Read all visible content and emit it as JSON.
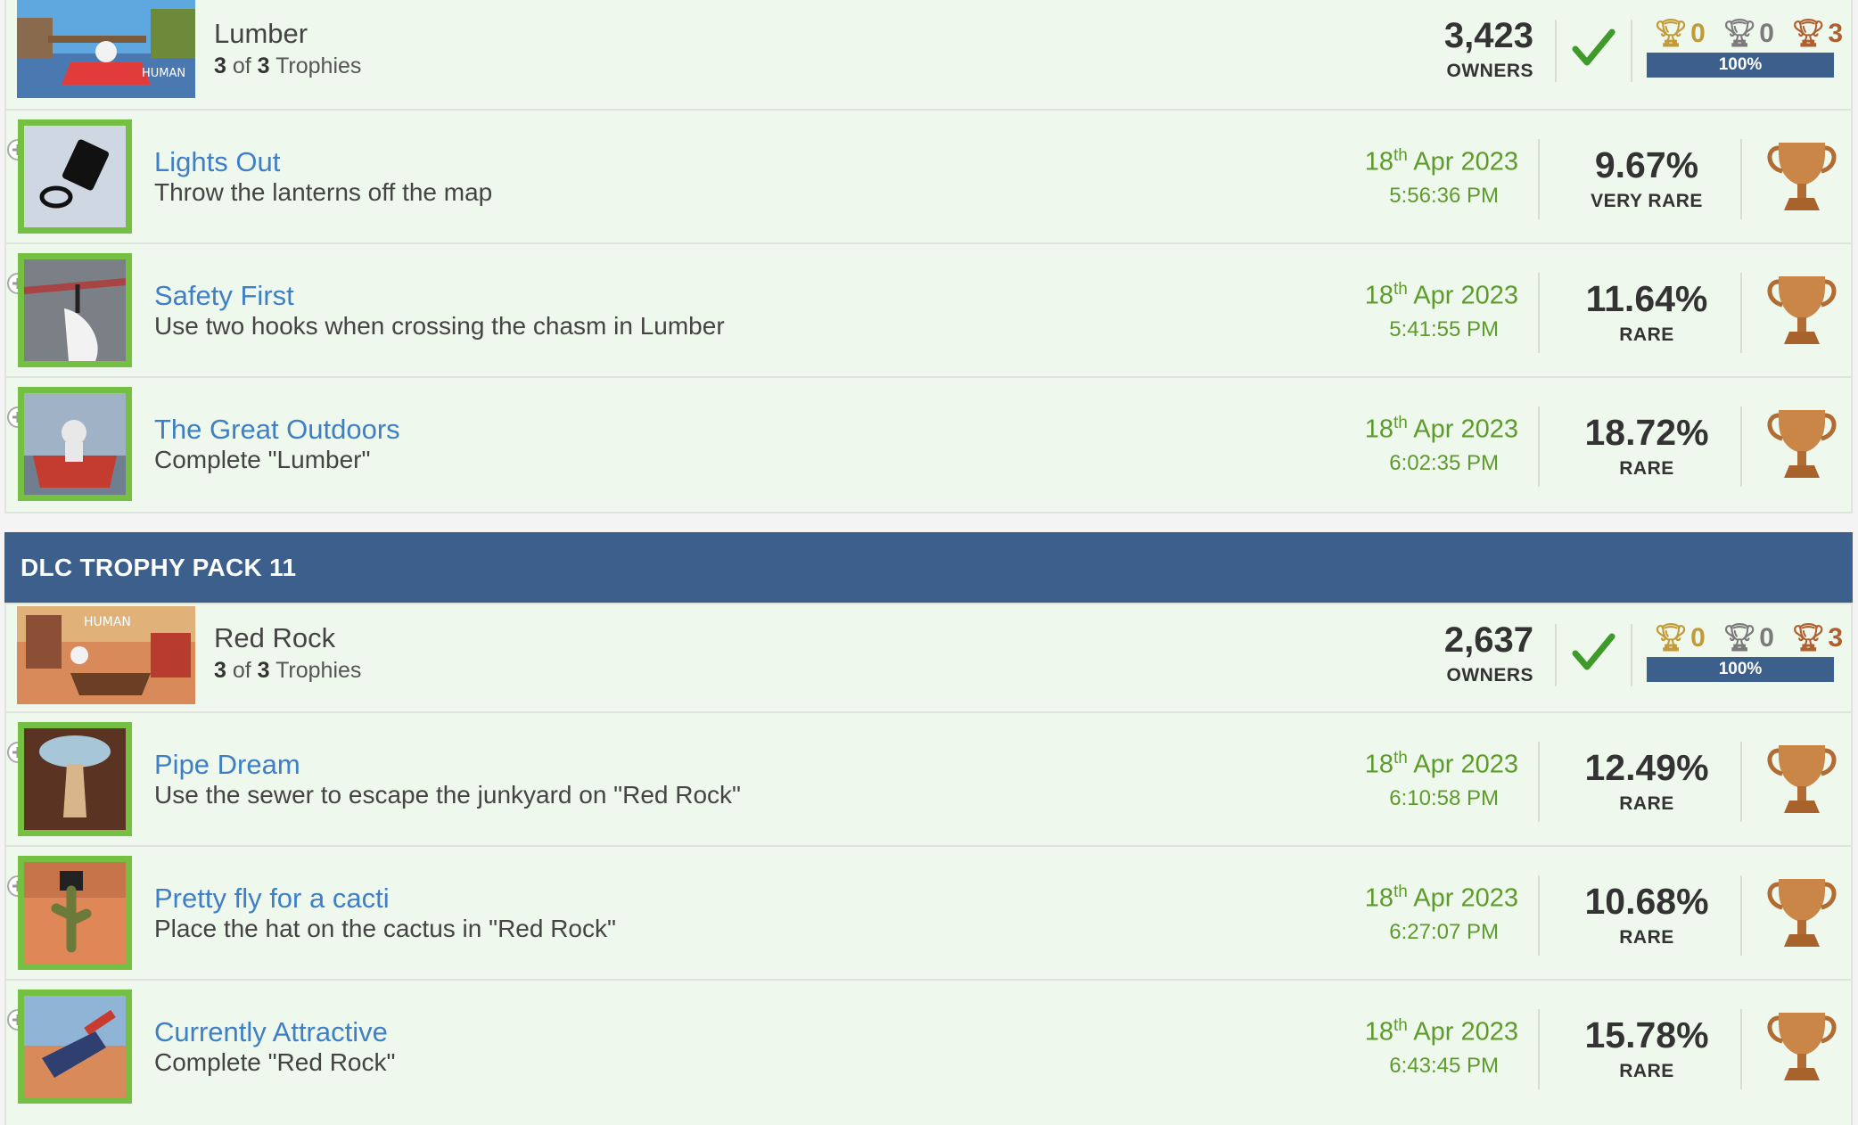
{
  "colors": {
    "accent_blue": "#3d5f8c",
    "link_blue": "#3e7fc6",
    "earned_green": "#5d9c2c",
    "row_bg": "#eff8ec",
    "bronze": "#b0602f"
  },
  "groups": [
    {
      "game": {
        "name": "Lumber",
        "earned": "3",
        "of": "of",
        "total": "3",
        "suffix": "Trophies",
        "owners": "3,423",
        "owners_label": "OWNERS",
        "gold": "0",
        "silver": "0",
        "bronze": "3",
        "progress": "100%"
      },
      "trophies": [
        {
          "name": "Lights Out",
          "desc": "Throw the lanterns off the map",
          "day": "18",
          "day_suffix": "th",
          "date_rest": " Apr 2023",
          "time": "5:56:36 PM",
          "pct": "9.67%",
          "rarity": "VERY RARE",
          "type": "bronze-trophy-icon"
        },
        {
          "name": "Safety First",
          "desc": "Use two hooks when crossing the chasm in Lumber",
          "day": "18",
          "day_suffix": "th",
          "date_rest": " Apr 2023",
          "time": "5:41:55 PM",
          "pct": "11.64%",
          "rarity": "RARE",
          "type": "bronze-trophy-icon"
        },
        {
          "name": "The Great Outdoors",
          "desc": "Complete \"Lumber\"",
          "day": "18",
          "day_suffix": "th",
          "date_rest": " Apr 2023",
          "time": "6:02:35 PM",
          "pct": "18.72%",
          "rarity": "RARE",
          "type": "bronze-trophy-icon"
        }
      ]
    },
    {
      "header": "DLC TROPHY PACK 11",
      "game": {
        "name": "Red Rock",
        "earned": "3",
        "of": "of",
        "total": "3",
        "suffix": "Trophies",
        "owners": "2,637",
        "owners_label": "OWNERS",
        "gold": "0",
        "silver": "0",
        "bronze": "3",
        "progress": "100%"
      },
      "trophies": [
        {
          "name": "Pipe Dream",
          "desc": "Use the sewer to escape the junkyard on \"Red Rock\"",
          "day": "18",
          "day_suffix": "th",
          "date_rest": " Apr 2023",
          "time": "6:10:58 PM",
          "pct": "12.49%",
          "rarity": "RARE",
          "type": "bronze-trophy-icon"
        },
        {
          "name": "Pretty fly for a cacti",
          "desc": "Place the hat on the cactus in \"Red Rock\"",
          "day": "18",
          "day_suffix": "th",
          "date_rest": " Apr 2023",
          "time": "6:27:07 PM",
          "pct": "10.68%",
          "rarity": "RARE",
          "type": "bronze-trophy-icon"
        },
        {
          "name": "Currently Attractive",
          "desc": "Complete \"Red Rock\"",
          "day": "18",
          "day_suffix": "th",
          "date_rest": " Apr 2023",
          "time": "6:43:45 PM",
          "pct": "15.78%",
          "rarity": "RARE",
          "type": "bronze-trophy-icon"
        }
      ]
    }
  ]
}
